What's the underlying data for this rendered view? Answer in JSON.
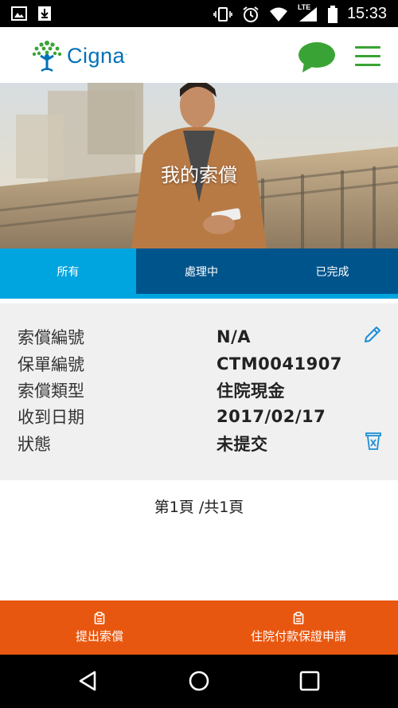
{
  "status_bar": {
    "time": "15:33",
    "network": "LTE",
    "icons": [
      "image-icon",
      "download-icon",
      "vibrate-icon",
      "alarm-icon",
      "wifi-icon",
      "signal-icon",
      "battery-icon"
    ]
  },
  "header": {
    "brand": "Cigna",
    "brand_mark": ".",
    "accent_color": "#3aa335",
    "brand_color": "#0071b8"
  },
  "hero": {
    "title": "我的索償"
  },
  "tabs": [
    {
      "label": "所有",
      "selected": true
    },
    {
      "label": "處理中",
      "selected": false
    },
    {
      "label": "已完成",
      "selected": false
    }
  ],
  "claim": {
    "rows": [
      {
        "label": "索償編號",
        "value": "N/A"
      },
      {
        "label": "保單編號",
        "value": "CTM0041907"
      },
      {
        "label": "索償類型",
        "value": "住院現金"
      },
      {
        "label": "收到日期",
        "value": "2017/02/17"
      },
      {
        "label": "狀態",
        "value": "未提交"
      }
    ]
  },
  "pager": {
    "text": "第1頁 /共1頁"
  },
  "bottom_actions": [
    {
      "label": "提出索償",
      "icon": "clipboard-icon"
    },
    {
      "label": "住院付款保證申請",
      "icon": "clipboard-icon"
    }
  ],
  "colors": {
    "tab_active": "#00a4de",
    "tab_inactive": "#00548c",
    "action_bar": "#e8570f"
  }
}
